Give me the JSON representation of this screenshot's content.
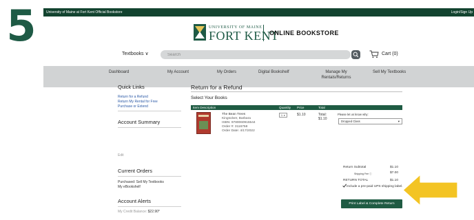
{
  "step_number": "5",
  "topbar": {
    "site": "University of Maine at Fort Kent Official Bookstore",
    "login": "Login/Sign Up"
  },
  "logo": {
    "small": "UNIVERSITY OF MAINE",
    "big": "FORT KENT",
    "store": "ONLINE BOOKSTORE"
  },
  "search": {
    "category": "Textbooks",
    "placeholder": "Search",
    "cart_label": "Cart (0)"
  },
  "nav": [
    "Dashboard",
    "My Account",
    "My Orders",
    "Digital Bookshelf",
    "Manage My Rentals/Returns",
    "Sell My Textbooks"
  ],
  "sidebar": {
    "quick_links_heading": "Quick Links",
    "quick_links": [
      "Return for a Refund",
      "Return My Rental for Free",
      "Purchase or Extend"
    ],
    "account_summary_heading": "Account Summary",
    "edit_link": "Edit",
    "current_orders_heading": "Current Orders",
    "current_orders": [
      "Purchased: Sell My Textbooks",
      "My eBookshelf"
    ],
    "account_alerts_heading": "Account Alerts",
    "credit_label": "My Credit Balance:",
    "credit_value": "$22.90*"
  },
  "main": {
    "title": "Return for a Refund",
    "subtitle": "Select Your Books",
    "columns": [
      "Item Description",
      "Quantity",
      "Price",
      "Total"
    ],
    "book": {
      "title": "The Bean Trees",
      "author": "Kingsolver, Barbara",
      "isbn": "ISBN: 9780060915544",
      "order": "Order #: 3116758",
      "order_date": "Order Date: 4/17/2022",
      "quantity": "1",
      "price": "$1.10",
      "total_label": "Total:",
      "total_value": "$1.10"
    },
    "reason_label": "Please let us know why:",
    "reason_value": "Dropped Class",
    "summary": {
      "subtotal_label": "Return Subtotal",
      "subtotal_value": "$1.10",
      "fee_label": "Shipping Fee",
      "fee_value": "$7.00",
      "total_label": "RETURN TOTAL",
      "total_value": "$1.10"
    },
    "ups_text": "Include a pre-paid UPS shipping label.",
    "print_button": "Print Label & Complete Return"
  },
  "colors": {
    "brand_green": "#1f5b43",
    "topbar_green": "#12432f",
    "nav_gray": "#d1d3d4",
    "arrow_yellow": "#f3c424",
    "link_blue": "#2b59a6"
  }
}
